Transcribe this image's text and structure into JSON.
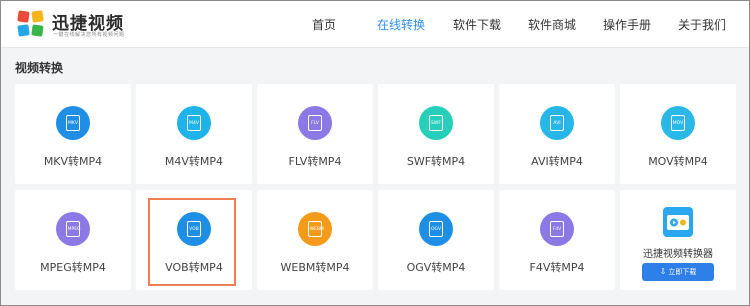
{
  "header": {
    "logo_title": "迅捷视频",
    "logo_slogan": "一键在线解决您所有视频问题",
    "nav": [
      {
        "label": "首页",
        "active": false
      },
      {
        "label": "在线转换",
        "active": true
      },
      {
        "label": "软件下载",
        "active": false
      },
      {
        "label": "软件商城",
        "active": false
      },
      {
        "label": "操作手册",
        "active": false
      },
      {
        "label": "关于我们",
        "active": false
      }
    ]
  },
  "section": {
    "title": "视频转换"
  },
  "converters": [
    {
      "format": "MKV",
      "label": "MKV转MP4",
      "color": "#1f8fe6"
    },
    {
      "format": "M4V",
      "label": "M4V转MP4",
      "color": "#1fb4e9"
    },
    {
      "format": "FLV",
      "label": "FLV转MP4",
      "color": "#8c79e6"
    },
    {
      "format": "SWF",
      "label": "SWF转MP4",
      "color": "#27cfba"
    },
    {
      "format": "AVI",
      "label": "AVI转MP4",
      "color": "#27b6e8"
    },
    {
      "format": "MOV",
      "label": "MOV转MP4",
      "color": "#2ab8e8"
    },
    {
      "format": "MPEG",
      "label": "MPEG转MP4",
      "color": "#8c79e6"
    },
    {
      "format": "VOB",
      "label": "VOB转MP4",
      "color": "#1f8fe6"
    },
    {
      "format": "WEBM",
      "label": "WEBM转MP4",
      "color": "#f59b1b"
    },
    {
      "format": "OGV",
      "label": "OGV转MP4",
      "color": "#1f8fe6"
    },
    {
      "format": "F4V",
      "label": "F4V转MP4",
      "color": "#8c79e6"
    }
  ],
  "promo": {
    "title": "迅捷视频转换器",
    "button_label": "立即下载"
  }
}
